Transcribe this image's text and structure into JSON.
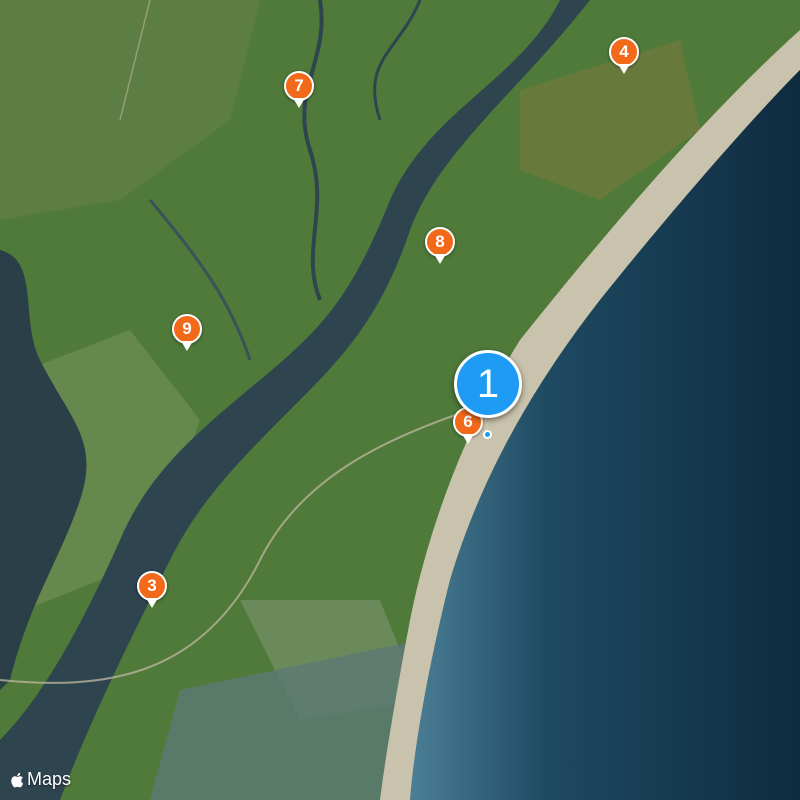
{
  "map": {
    "attribution": "Maps",
    "attribution_icon": "apple-logo-icon",
    "colors": {
      "land": "#4f7a3a",
      "marsh": "#6f8f55",
      "river": "#2e4550",
      "ocean_shallow": "#3d6d85",
      "ocean_deep": "#0f2b3f",
      "beach": "#c9c2ac",
      "pin": "#f2691a",
      "selected_pin": "#1e9bf2"
    }
  },
  "selected_marker": {
    "label": "1"
  },
  "markers": [
    {
      "label": "4"
    },
    {
      "label": "7"
    },
    {
      "label": "8"
    },
    {
      "label": "9"
    },
    {
      "label": "6"
    },
    {
      "label": "3"
    }
  ]
}
